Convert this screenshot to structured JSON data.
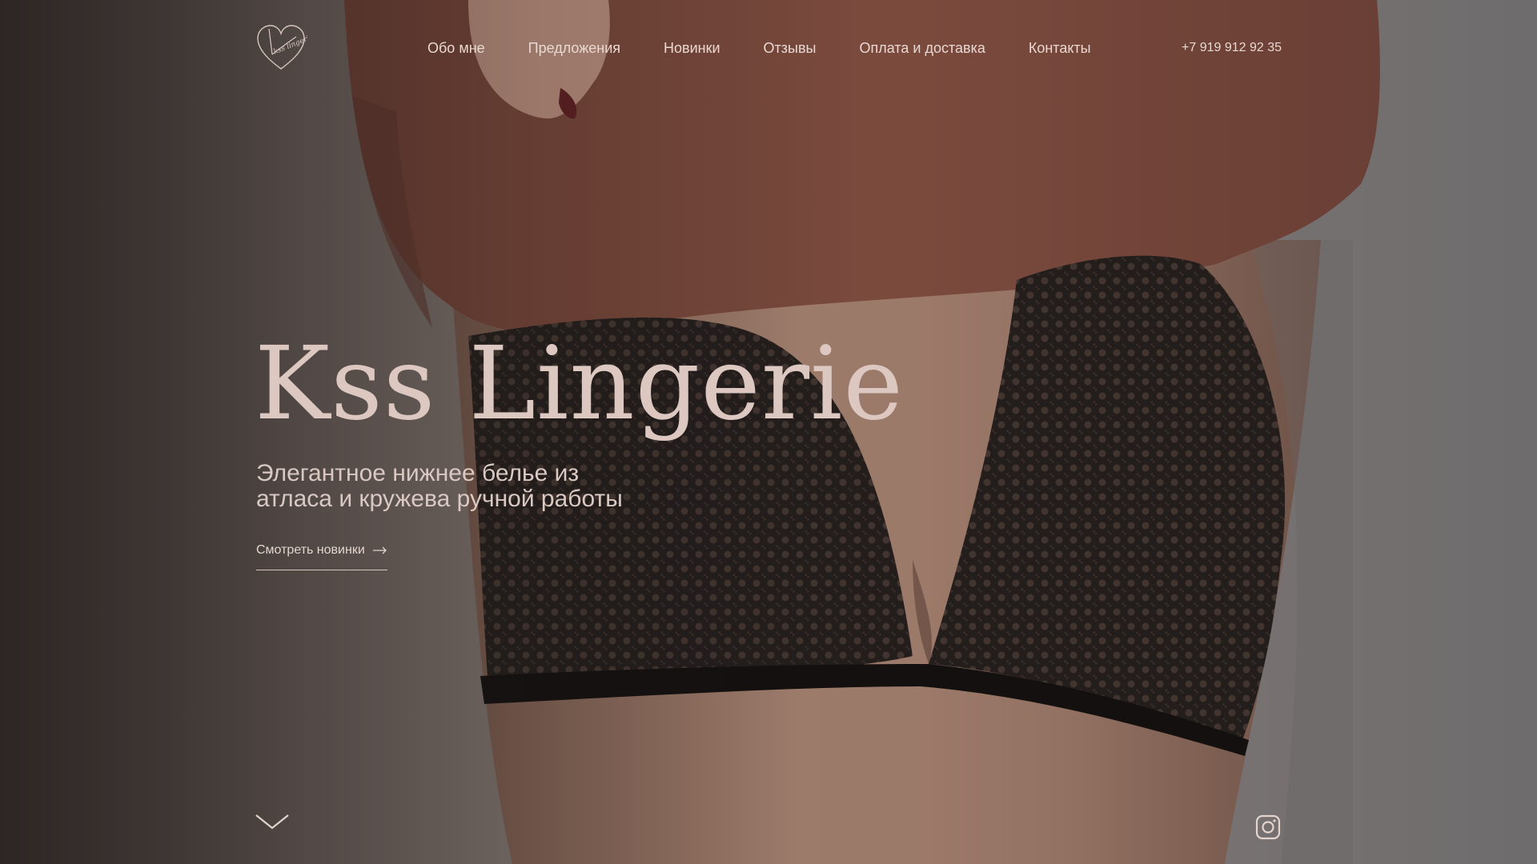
{
  "brand": {
    "logo_text": "kss lingerie",
    "title": "Kss Lingerie",
    "tagline_line1": "Элегантное нижнее белье из",
    "tagline_line2": "атласа и кружева ручной работы"
  },
  "nav": {
    "items": [
      {
        "label": "Обо мне"
      },
      {
        "label": "Предложения"
      },
      {
        "label": "Новинки"
      },
      {
        "label": "Отзывы"
      },
      {
        "label": "Оплата и доставка"
      },
      {
        "label": "Контакты"
      }
    ],
    "phone": "+7 919 912 92 35"
  },
  "hero": {
    "cta_label": "Смотреть новинки",
    "cta_icon": "arrow-right-icon",
    "scroll_icon": "chevron-down-icon",
    "social_icon": "instagram-icon"
  },
  "colors": {
    "text": "#e3d4ce",
    "title": "#dcc8c1",
    "sweater": "#7a4a3d",
    "lace": "#1c1818",
    "skin": "#9b7a6c"
  }
}
